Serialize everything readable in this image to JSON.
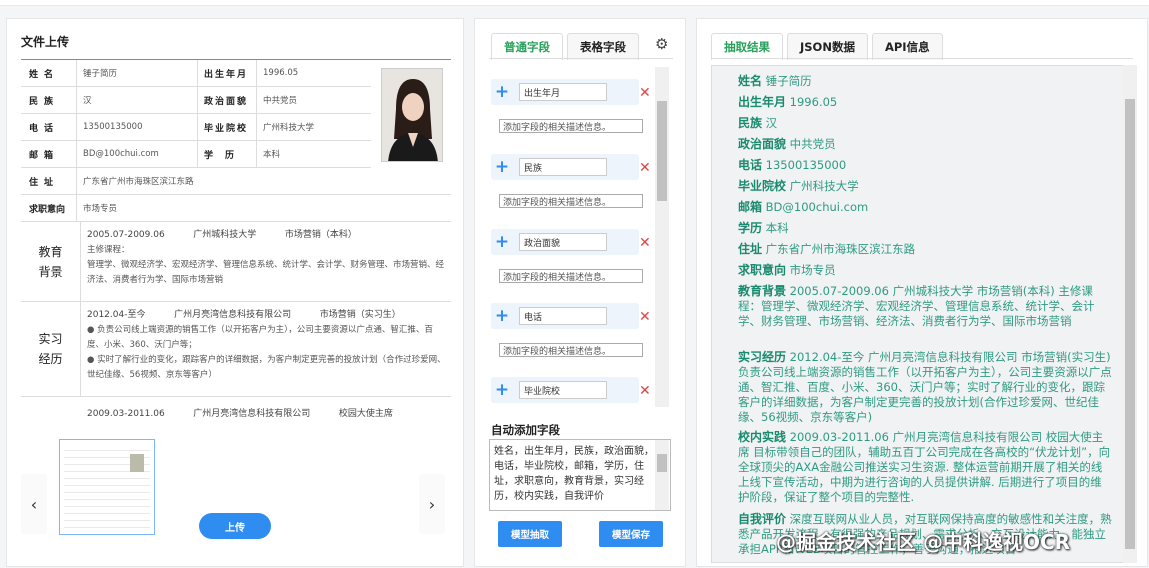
{
  "left": {
    "title": "文件上传",
    "resume": {
      "rows": [
        {
          "label": "姓名",
          "value": "锤子简历",
          "label2": "出生年月",
          "value2": "1996.05"
        },
        {
          "label": "民族",
          "value": "汉",
          "label2": "政治面貌",
          "value2": "中共党员"
        },
        {
          "label": "电话",
          "value": "13500135000",
          "label2": "毕业院校",
          "value2": "广州科技大学"
        },
        {
          "label": "邮箱",
          "value": "BD@100chui.com",
          "label2": "学历",
          "value2": "本科"
        },
        {
          "label": "住址",
          "value": "广东省广州市海珠区滨江东路"
        },
        {
          "label": "求职意向",
          "value": "市场专员"
        }
      ],
      "edu": {
        "label": "教育背景",
        "period": "2005.07-2009.06",
        "school": "广州城科技大学",
        "major": "市场营销（本科）",
        "courses_label": "主修课程：",
        "courses": "管理学、微观经济学、宏观经济学、管理信息系统、统计学、会计学、财务管理、市场营销、经济法、消费者行为学、国际市场营销"
      },
      "work": {
        "label": "实习经历",
        "period": "2012.04-至今",
        "company": "广州月亮湾信息科技有限公司",
        "role": "市场营销（实习生）",
        "bullet1": "负责公司线上端资源的销售工作（以开拓客户为主），公司主要资源以广点通、智汇推、百度、小米、360、沃门户等；",
        "bullet2": "实时了解行业的变化，跟踪客户的详细数据，为客户制定更完善的投放计划（合作过珍爱网、世纪佳缘、56视频、京东等客户）"
      },
      "next": {
        "period": "2009.03-2011.06",
        "company": "广州月亮湾信息科技有限公司",
        "role": "校园大使主席"
      }
    },
    "upload_label": "上传",
    "prev_icon": "‹",
    "next_icon": "›"
  },
  "mid": {
    "tabs": [
      "普通字段",
      "表格字段"
    ],
    "fields": [
      {
        "name": "出生年月",
        "desc": "添加字段的相关描述信息。"
      },
      {
        "name": "民族",
        "desc": "添加字段的相关描述信息。"
      },
      {
        "name": "政治面貌",
        "desc": "添加字段的相关描述信息。"
      },
      {
        "name": "电话",
        "desc": "添加字段的相关描述信息。"
      },
      {
        "name": "毕业院校",
        "desc": ""
      }
    ],
    "auto_label": "自动添加字段",
    "auto_text": "姓名，出生年月，民族，政治面貌，电话，毕业院校，邮箱，学历，住址，求职意向，教育背景，实习经历，校内实践，自我评价",
    "btn_extract": "模型抽取",
    "btn_save": "模型保存"
  },
  "right": {
    "tabs": [
      "抽取结果",
      "JSON数据",
      "API信息"
    ],
    "items": [
      {
        "k": "姓名",
        "v": "锤子简历"
      },
      {
        "k": "出生年月",
        "v": "1996.05"
      },
      {
        "k": "民族",
        "v": "汉"
      },
      {
        "k": "政治面貌",
        "v": "中共党员"
      },
      {
        "k": "电话",
        "v": "13500135000"
      },
      {
        "k": "毕业院校",
        "v": "广州科技大学"
      },
      {
        "k": "邮箱",
        "v": "BD@100chui.com"
      },
      {
        "k": "学历",
        "v": "本科"
      },
      {
        "k": "住址",
        "v": "广东省广州市海珠区滨江东路"
      },
      {
        "k": "求职意向",
        "v": "市场专员"
      }
    ],
    "edu": {
      "k": "教育背景",
      "v": "2005.07-2009.06 广州城科技大学 市场营销(本科) 主修课程：管理学、微观经济学、宏观经济学、管理信息系统、统计学、会计学、财务管理、市场营销、经济法、消费者行为学、国际市场营销"
    },
    "work": {
      "k": "实习经历",
      "v": "2012.04-至今 广州月亮湾信息科技有限公司 市场营销(实习生) 负责公司线上端资源的销售工作（以开拓客户为主），公司主要资源以广点通、智汇推、百度、小米、360、沃门户等；实时了解行业的变化，跟踪客户的详细数据，为客户制定更完善的投放计划(合作过珍爱网、世纪佳缘、56视频、京东等客户)"
    },
    "campus": {
      "k": "校内实践",
      "v": "2009.03-2011.06 广州月亮湾信息科技有限公司 校园大使主席 目标带领自己的团队，辅助五百丁公司完成在各高校的“伏龙计划”，向全球顶尖的AXA金融公司推送实习生资源. 整体运营前期开展了相关的线上线下宣传活动，中期为进行咨询的人员提供讲解. 后期进行了项目的维护阶段，保证了整个项目的完整性."
    },
    "self": {
      "k": "自我评价",
      "v": "深度互联网从业人员，对互联网保持高度的敏感性和关注度，熟悉产品开发流程，有很强的产品规划、需求分析、交互设计能力，能独立承担APP和WEB项目的管控工作，善于沟通，推进项目"
    }
  },
  "watermark": "@掘金技术社区 @中科逸视OCR"
}
